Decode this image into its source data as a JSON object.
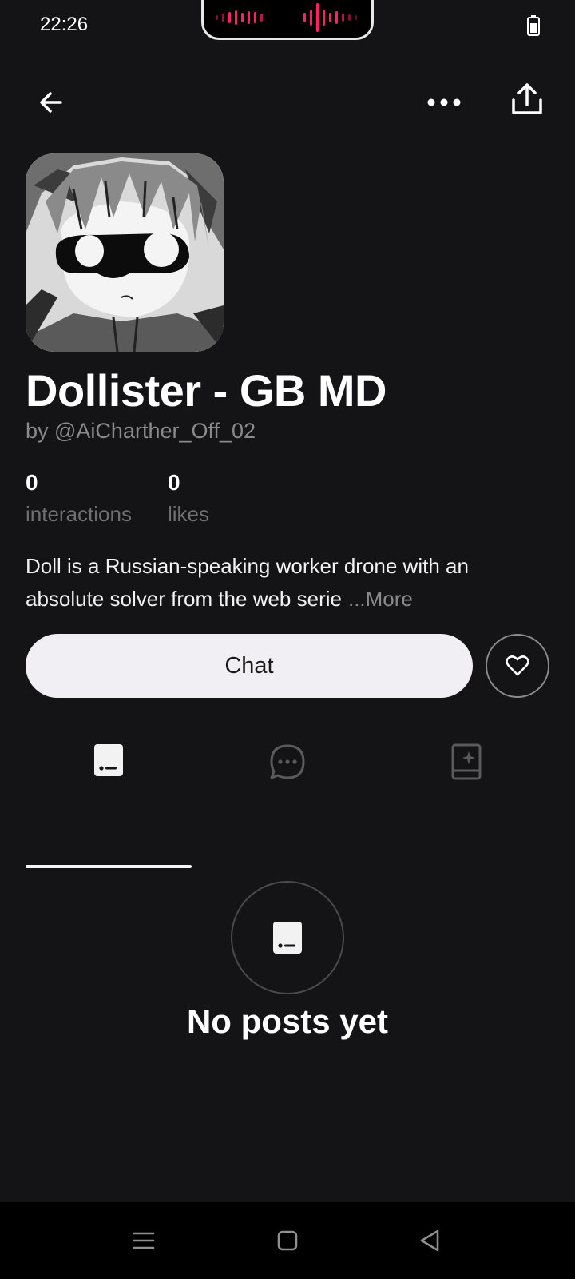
{
  "status_bar": {
    "time": "22:26"
  },
  "character": {
    "name": "Dollister - GB MD",
    "author": "by @AiCharther_Off_02",
    "stats": [
      {
        "value": "0",
        "label": "interactions"
      },
      {
        "value": "0",
        "label": "likes"
      }
    ],
    "description": "Doll is a Russian-speaking worker drone with an absolute solver from the web serie",
    "more_label": "...More"
  },
  "actions": {
    "chat_label": "Chat"
  },
  "tabs": [
    {
      "icon": "posts-icon",
      "active": true
    },
    {
      "icon": "chat-bubble-icon",
      "active": false
    },
    {
      "icon": "memory-book-icon",
      "active": false
    }
  ],
  "empty_state": {
    "text": "No posts yet"
  },
  "colors": {
    "background": "#141316",
    "chat_button_bg": "#f1eff3",
    "muted_text": "#8a898e",
    "island_accent": "#ff1f6a"
  }
}
